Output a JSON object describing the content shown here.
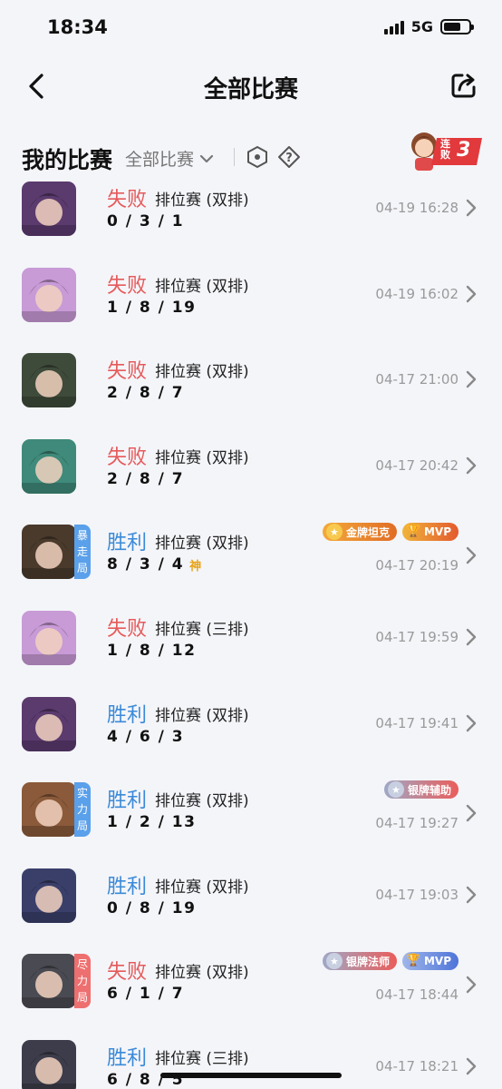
{
  "status": {
    "time": "18:34",
    "network": "5G",
    "battery_level": 0.7
  },
  "nav": {
    "title": "全部比赛",
    "back_icon": "chevron-left-icon",
    "share_icon": "share-icon"
  },
  "section": {
    "title": "我的比赛",
    "filter_label": "全部比赛",
    "streak": {
      "text": "连败",
      "count": "3"
    }
  },
  "colors": {
    "lose": "#e65a5a",
    "win": "#3b8ad8",
    "gold_badge": "#f3a93a",
    "silver_badge": "#9fa8c6",
    "mvp_blue": "#4f74d8"
  },
  "matches": [
    {
      "result": "失败",
      "outcome": "lose",
      "mode": "排位赛 (双排)",
      "kda": "0 / 3 / 1",
      "time": "04-19 16:28",
      "hero_color": "#5b3a6e",
      "tag": "",
      "tag_color": "",
      "god": "",
      "badges": []
    },
    {
      "result": "失败",
      "outcome": "lose",
      "mode": "排位赛 (双排)",
      "kda": "1 / 8 / 19",
      "time": "04-19 16:02",
      "hero_color": "#c89ad6",
      "tag": "",
      "tag_color": "",
      "god": "",
      "badges": []
    },
    {
      "result": "失败",
      "outcome": "lose",
      "mode": "排位赛 (双排)",
      "kda": "2 / 8 / 7",
      "time": "04-17 21:00",
      "hero_color": "#3e4a3a",
      "tag": "",
      "tag_color": "",
      "god": "",
      "badges": []
    },
    {
      "result": "失败",
      "outcome": "lose",
      "mode": "排位赛 (双排)",
      "kda": "2 / 8 / 7",
      "time": "04-17 20:42",
      "hero_color": "#3f8a7a",
      "tag": "",
      "tag_color": "",
      "god": "",
      "badges": []
    },
    {
      "result": "胜利",
      "outcome": "win",
      "mode": "排位赛 (双排)",
      "kda": "8 / 3 / 4",
      "time": "04-17 20:19",
      "hero_color": "#4a3a2c",
      "tag": "暴走局",
      "tag_color": "blue",
      "god": "神",
      "badges": [
        {
          "label": "金牌坦克",
          "style": "gold"
        },
        {
          "label": "MVP",
          "style": "mvp-gold"
        }
      ]
    },
    {
      "result": "失败",
      "outcome": "lose",
      "mode": "排位赛 (三排)",
      "kda": "1 / 8 / 12",
      "time": "04-17 19:59",
      "hero_color": "#c89ad6",
      "tag": "",
      "tag_color": "",
      "god": "",
      "badges": []
    },
    {
      "result": "胜利",
      "outcome": "win",
      "mode": "排位赛 (双排)",
      "kda": "4 / 6 / 3",
      "time": "04-17 19:41",
      "hero_color": "#5b3a6e",
      "tag": "",
      "tag_color": "",
      "god": "",
      "badges": []
    },
    {
      "result": "胜利",
      "outcome": "win",
      "mode": "排位赛 (双排)",
      "kda": "1 / 2 / 13",
      "time": "04-17 19:27",
      "hero_color": "#8a5a3a",
      "tag": "实力局",
      "tag_color": "blue",
      "god": "",
      "badges": [
        {
          "label": "银牌辅助",
          "style": "silver"
        }
      ]
    },
    {
      "result": "胜利",
      "outcome": "win",
      "mode": "排位赛 (双排)",
      "kda": "0 / 8 / 19",
      "time": "04-17 19:03",
      "hero_color": "#3a3f6a",
      "tag": "",
      "tag_color": "",
      "god": "",
      "badges": []
    },
    {
      "result": "失败",
      "outcome": "lose",
      "mode": "排位赛 (双排)",
      "kda": "6 / 1 / 7",
      "time": "04-17 18:44",
      "hero_color": "#4a4a52",
      "tag": "尽力局",
      "tag_color": "red",
      "god": "",
      "badges": [
        {
          "label": "银牌法师",
          "style": "silver"
        },
        {
          "label": "MVP",
          "style": "mvp-blue"
        }
      ]
    },
    {
      "result": "胜利",
      "outcome": "win",
      "mode": "排位赛 (三排)",
      "kda": "6 / 8 / 5",
      "time": "04-17 18:21",
      "hero_color": "#3c3c4a",
      "tag": "",
      "tag_color": "",
      "god": "",
      "badges": []
    }
  ]
}
